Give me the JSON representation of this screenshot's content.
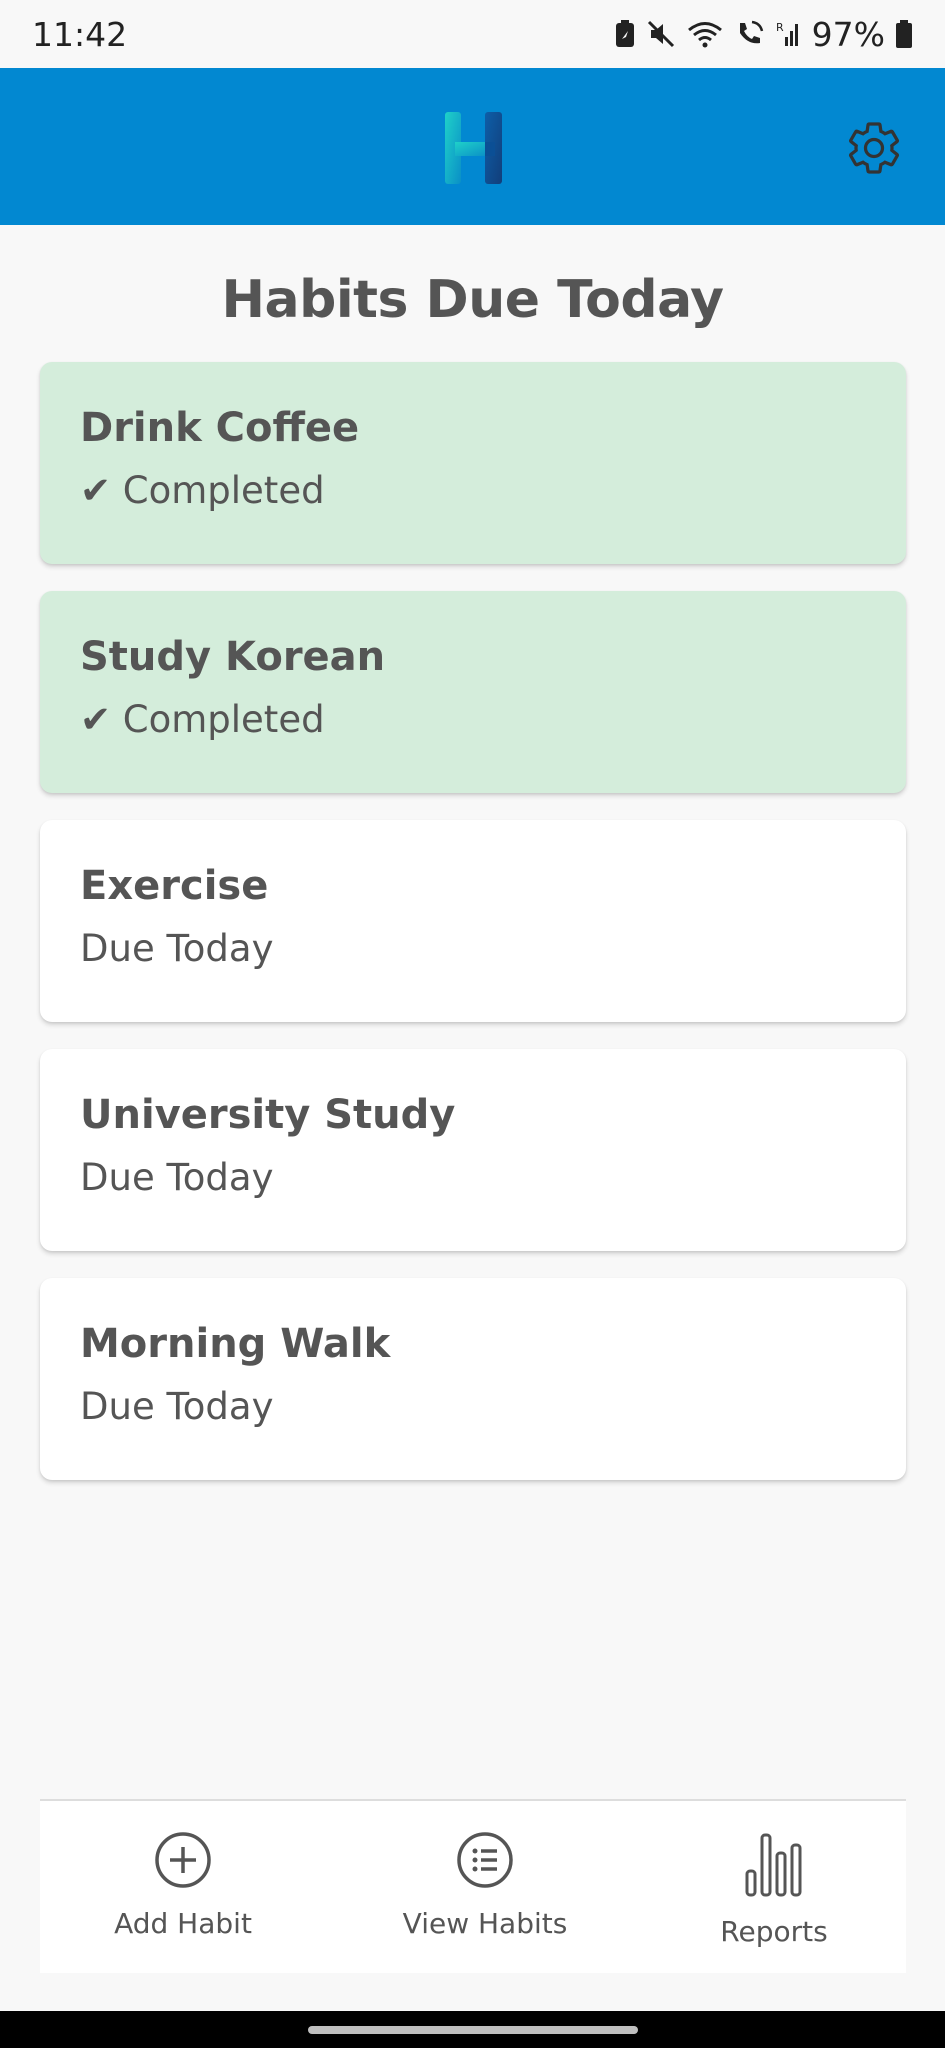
{
  "status_bar": {
    "time": "11:42",
    "battery": "97%",
    "icons": [
      "battery-saver-icon",
      "mute-icon",
      "wifi-icon",
      "wifi-calling-icon",
      "signal-icon",
      "battery-icon"
    ]
  },
  "app_bar": {
    "logo_icon": "habit-h-logo",
    "settings_icon": "gear-icon",
    "background": "#0288d1"
  },
  "main": {
    "title": "Habits Due Today",
    "habits": [
      {
        "name": "Drink Coffee",
        "status": "✔ Completed",
        "completed": true
      },
      {
        "name": "Study Korean",
        "status": "✔ Completed",
        "completed": true
      },
      {
        "name": "Exercise",
        "status": "Due Today",
        "completed": false
      },
      {
        "name": "University Study",
        "status": "Due Today",
        "completed": false
      },
      {
        "name": "Morning Walk",
        "status": "Due Today",
        "completed": false
      }
    ],
    "colors": {
      "completed_card": "#d4eddb",
      "due_card": "#ffffff"
    }
  },
  "bottom_nav": {
    "items": [
      {
        "label": "Add Habit",
        "icon": "add-circle-icon"
      },
      {
        "label": "View Habits",
        "icon": "list-circle-icon"
      },
      {
        "label": "Reports",
        "icon": "bar-chart-icon"
      }
    ]
  }
}
